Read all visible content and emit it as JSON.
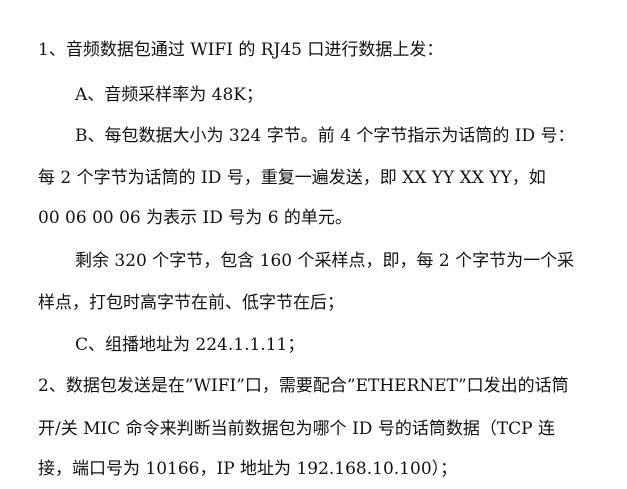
{
  "document": {
    "lines": [
      "1、音频数据包通过 WIFI 的 RJ45 口进行数据上发：",
      "A、音频采样率为 48K；",
      "B、每包数据大小为 324 字节。前 4 个字节指示为话筒的 ID 号：",
      "每 2 个字节为话筒的 ID 号，重复一遍发送，即 XX YY XX YY，如",
      "00 06 00 06 为表示 ID 号为 6 的单元。",
      "剩余 320 个字节，包含 160 个采样点，即，每 2 个字节为一个采",
      "样点，打包时高字节在前、低字节在后；",
      "C、组播地址为 224.1.1.11；",
      "2、数据包发送是在”WIFI”口，需要配合”ETHERNET”口发出的话筒",
      "开/关 MIC 命令来判断当前数据包为哪个 ID 号的话筒数据（TCP 连",
      "接，端口号为 10166，IP 地址为 192.168.10.100）；"
    ]
  }
}
